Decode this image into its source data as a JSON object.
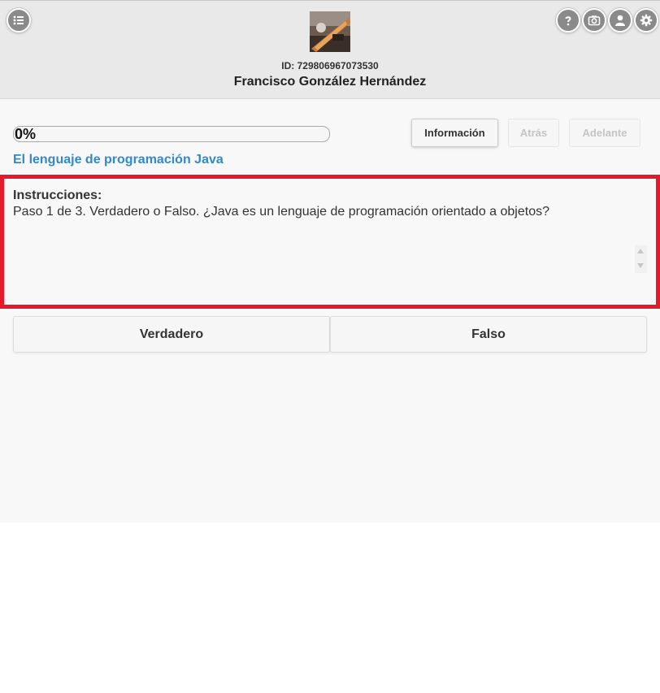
{
  "header": {
    "user_id": "ID: 729806967073530",
    "user_name": "Francisco González Hernández",
    "icons": {
      "menu": "list-icon",
      "help": "help-icon",
      "camera": "camera-icon",
      "profile": "user-icon",
      "settings": "gear-icon"
    }
  },
  "progress": {
    "value": 0,
    "label": "0%"
  },
  "toolbar": {
    "info_label": "Información",
    "back_label": "Atrás",
    "next_label": "Adelante"
  },
  "lesson": {
    "title": "El lenguaje de programación Java"
  },
  "instructions": {
    "heading": "Instrucciones:",
    "text": "Paso 1 de 3. Verdadero o Falso. ¿Java es un lenguaje de programación orientado a objetos?"
  },
  "answers": {
    "true_label": "Verdadero",
    "false_label": "Falso"
  },
  "colors": {
    "accent": "#3388cc",
    "highlight": "#e6192b",
    "header_bg": "#e9e9e9",
    "content_bg": "#f8f8f8"
  }
}
